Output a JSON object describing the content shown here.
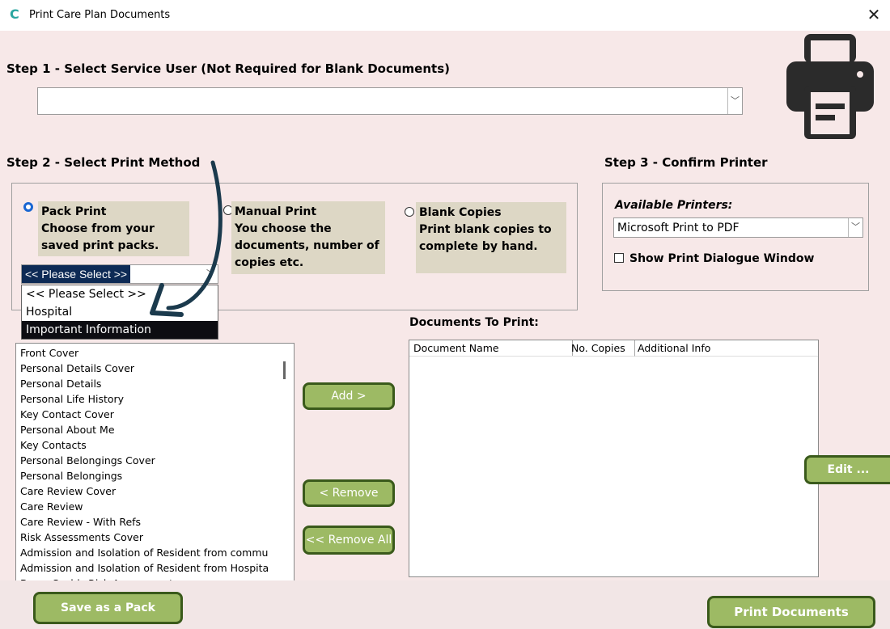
{
  "window": {
    "title": "Print Care Plan Documents",
    "close_glyph": "✕",
    "app_icon_glyph": "C"
  },
  "step1": {
    "heading": "Step 1 - Select Service User (Not Required for Blank Documents)",
    "service_user_value": ""
  },
  "step2": {
    "heading": "Step 2 - Select Print Method",
    "options": [
      {
        "label": "Pack Print",
        "description": "Choose from your saved print packs.",
        "selected": true
      },
      {
        "label": "Manual Print",
        "description": "You choose the documents, number of copies etc.",
        "selected": false
      },
      {
        "label": "Blank Copies",
        "description": "Print blank copies to complete by hand.",
        "selected": false
      }
    ],
    "pack_select": {
      "value": "<< Please Select >>",
      "options": [
        "<< Please Select >>",
        "Hospital",
        "Important Information"
      ],
      "highlighted_index": 2
    }
  },
  "step3": {
    "heading": "Step 3 - Confirm Printer",
    "available_label": "Available Printers:",
    "printer_value": "Microsoft Print to PDF",
    "show_dialog_label": "Show Print Dialogue Window",
    "show_dialog_checked": false
  },
  "documents_list": [
    "Front Cover",
    "Personal Details Cover",
    "Personal Details",
    "Personal Life History",
    "Key Contact Cover",
    "Personal About Me",
    "Key Contacts",
    "Personal Belongings Cover",
    "Personal Belongings",
    "Care Review Cover",
    "Care Review",
    "Care Review - With Refs",
    "Risk Assessments Cover",
    "Admission and Isolation of Resident from commu",
    "Admission and Isolation of Resident from Hospita",
    "Burns Scalds Risk Assessment"
  ],
  "documents_to_print": {
    "heading": "Documents To Print:",
    "columns": [
      "Document Name",
      "No. Copies",
      "Additional Info"
    ],
    "rows": []
  },
  "buttons": {
    "add": "Add >",
    "remove": "< Remove",
    "remove_all": "<< Remove All",
    "edit": "Edit ...",
    "save_pack": "Save as a Pack",
    "print": "Print Documents"
  },
  "colors": {
    "background": "#f7e8e8",
    "option_box": "#ddd7c5",
    "button_fill": "#9dba64",
    "button_border": "#3a5a1b",
    "arrow": "#1b3a4d"
  }
}
